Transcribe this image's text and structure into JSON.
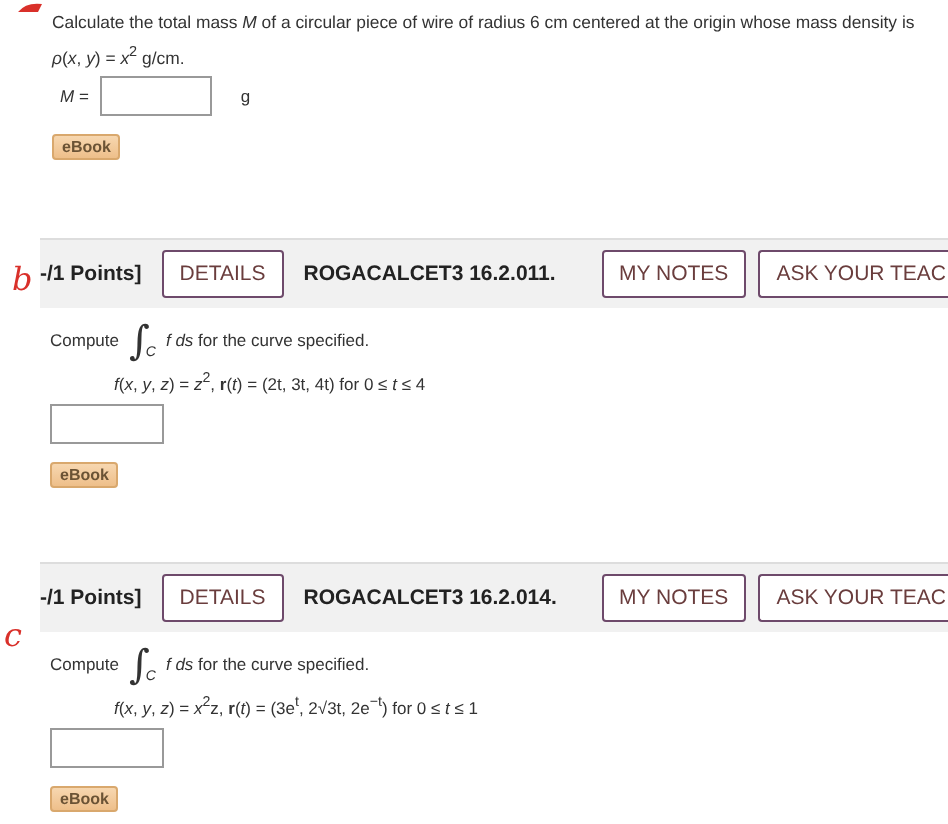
{
  "problem_1": {
    "text_line_1": "Calculate the total mass *M* of a circular piece of wire of radius 6 cm centered at the origin whose mass density is",
    "text_line_2": "*ρ*(*x*, *y*) = *x*$^{2}$ g/cm.",
    "answer_label": "*M* =",
    "unit": "g",
    "ebook": "eBook"
  },
  "problems": [
    {
      "annotation": "b",
      "points": "-/1 Points]",
      "details": "DETAILS",
      "code": "ROGACALCET3 16.2.011.",
      "buttons": [
        "MY NOTES",
        "ASK YOUR TEAC"
      ],
      "prompt_before": "Compute",
      "integral": "∫",
      "integral_sub": "C",
      "prompt_after": "*f ds*  for the curve specified.",
      "formula": "*f*(*x*, *y*, *z*) = *z*$^{2}$,  **r**(*t*) = (2t, 3t, 4t)  for  0 ≤ *t* ≤ 4",
      "ebook": "eBook"
    },
    {
      "annotation": "c",
      "points": "-/1 Points]",
      "details": "DETAILS",
      "code": "ROGACALCET3 16.2.014.",
      "buttons": [
        "MY NOTES",
        "ASK YOUR TEAC"
      ],
      "prompt_before": "Compute",
      "integral": "∫",
      "integral_sub": "C",
      "prompt_after": "*f ds*  for the curve specified.",
      "formula": "*f*(*x*, *y*, *z*) = *x*$^{2}$z,  **r**(*t*) = (3e$^{t}$, 2√3t, 2e$^{−t}$)  for  0 ≤ *t* ≤ 1",
      "ebook": "eBook"
    }
  ]
}
